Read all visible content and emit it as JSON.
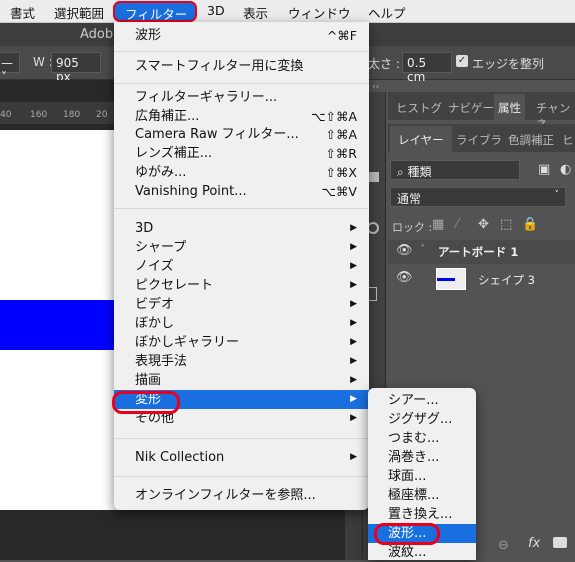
{
  "menubar": {
    "items": [
      "書式",
      "選択範囲",
      "フィルター",
      "3D",
      "表示",
      "ウィンドウ",
      "ヘルプ"
    ]
  },
  "titlebar": {
    "title": "Adob"
  },
  "options": {
    "w_label": "W :",
    "w_value": "905 px",
    "stroke_label": "の太さ :",
    "stroke_value": "0.5 cm",
    "align_edges_label": "エッジを整列",
    "align_edges_checked": true
  },
  "ruler": {
    "ticks": [
      "40",
      "160",
      "180",
      "20"
    ]
  },
  "colors": {
    "accent": "#1a6fe0",
    "highlight_ring": "#e8001c",
    "shape_fill": "#0000ff"
  },
  "filter_menu": {
    "last_filter": {
      "label": "波形",
      "shortcut": "^⌘F"
    },
    "smart": "スマートフィルター用に変換",
    "group1": [
      {
        "label": "フィルターギャラリー...",
        "shortcut": ""
      },
      {
        "label": "広角補正...",
        "shortcut": "⌥⇧⌘A"
      },
      {
        "label": "Camera Raw フィルター...",
        "shortcut": "⇧⌘A"
      },
      {
        "label": "レンズ補正...",
        "shortcut": "⇧⌘R"
      },
      {
        "label": "ゆがみ...",
        "shortcut": "⇧⌘X"
      },
      {
        "label": "Vanishing Point...",
        "shortcut": "⌥⌘V"
      }
    ],
    "submenus": [
      "3D",
      "シャープ",
      "ノイズ",
      "ピクセレート",
      "ビデオ",
      "ぼかし",
      "ぼかしギャラリー",
      "表現手法",
      "描画",
      "変形",
      "その他"
    ],
    "selected_submenu": "変形",
    "nik": "Nik Collection",
    "online": "オンラインフィルターを参照..."
  },
  "distort_submenu": {
    "items": [
      "シアー...",
      "ジグザグ...",
      "つまむ...",
      "渦巻き...",
      "球面...",
      "極座標...",
      "置き換え...",
      "波形...",
      "波紋..."
    ],
    "selected": "波形..."
  },
  "panels": {
    "top_tabs": [
      "ヒストグ",
      "ナビゲー",
      "属性",
      "チャンネ"
    ],
    "top_active": "属性",
    "layer_tabs": [
      "レイヤー",
      "ライブラ",
      "色調補正",
      "ヒ"
    ],
    "layer_active": "レイヤー",
    "filter_kind": "種類",
    "blend_mode": "通常",
    "lock_label": "ロック :",
    "layers": [
      {
        "name": "アートボード 1",
        "type": "artboard",
        "visible": true
      },
      {
        "name": "シェイプ 3",
        "type": "shape",
        "visible": true
      }
    ],
    "footer_icons": [
      "link-icon",
      "fx-icon",
      "mask-icon"
    ],
    "fx_label": "fx"
  }
}
